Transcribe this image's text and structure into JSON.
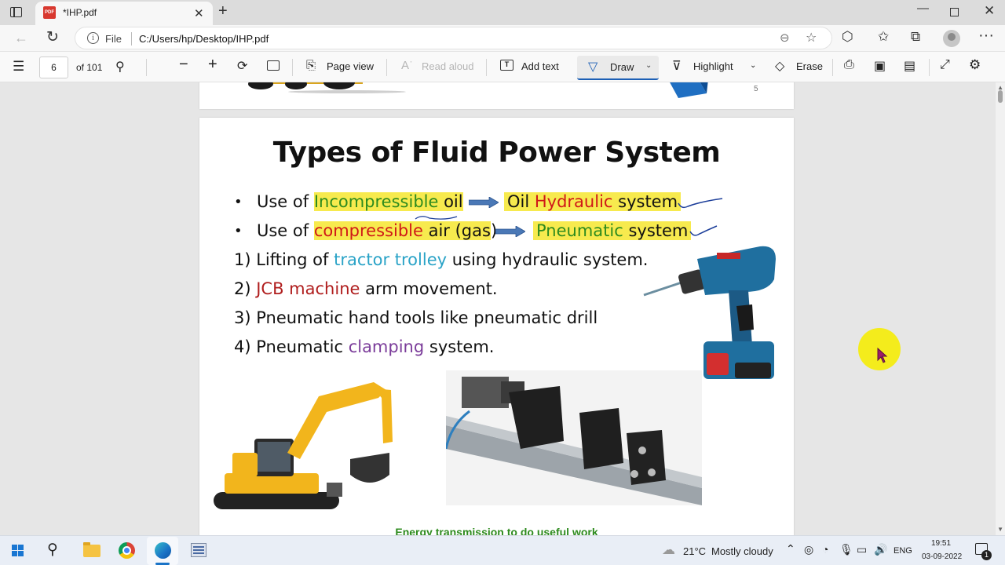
{
  "browser": {
    "tab_title": "*IHP.pdf",
    "favicon_text": "PDF",
    "tab_close": "✕",
    "new_tab": "+",
    "window_controls": {
      "minimize": "—",
      "close": "✕"
    },
    "address": {
      "site_label": "File",
      "url": "C:/Users/hp/Desktop/IHP.pdf"
    }
  },
  "pdf_toolbar": {
    "page_number": "6",
    "page_total": "of 101",
    "page_view_label": "Page view",
    "read_aloud_label": "Read aloud",
    "add_text_label": "Add text",
    "draw_label": "Draw",
    "highlight_label": "Highlight",
    "erase_label": "Erase",
    "accent": "#1c5fb5"
  },
  "document": {
    "prev_page_number": "5",
    "title": "Types of Fluid Power System",
    "bullets": [
      {
        "dot": "•",
        "prefix": "Use of ",
        "highlight_colored": "Incompressible",
        "highlight_plain": " oil",
        "result_plain": "Oil ",
        "result_colored": "Hydraulic",
        "result_suffix": " system"
      },
      {
        "dot": "•",
        "prefix": "Use of ",
        "highlight_colored": "compressible",
        "highlight_plain": " air (gas",
        "after_highlight": ")",
        "result_colored": "Pneumatic",
        "result_suffix": " system"
      }
    ],
    "numbered": [
      {
        "num": "1) ",
        "pre": "Lifting of ",
        "colored": "tractor trolley",
        "post": " using hydraulic system."
      },
      {
        "num": "2) ",
        "colored": "JCB machine",
        "post": " arm movement."
      },
      {
        "num": "3) ",
        "pre": "Pneumatic hand tools like pneumatic drill"
      },
      {
        "num": "4)  ",
        "pre": "Pneumatic ",
        "colored": "clamping",
        "post": " system."
      }
    ],
    "footer_caption": "Energy transmission to do useful work",
    "colors": {
      "highlight": "#f7ea4e",
      "green": "#2e8b1e",
      "red": "#d01818",
      "cyan": "#2aa3c7",
      "purple": "#7b3c9a",
      "pointer": "#f4ec1c"
    }
  },
  "taskbar": {
    "weather_temp": "21°C",
    "weather_desc": "Mostly cloudy",
    "language": "ENG",
    "time": "19:51",
    "date": "03-09-2022",
    "notification_count": "1"
  }
}
